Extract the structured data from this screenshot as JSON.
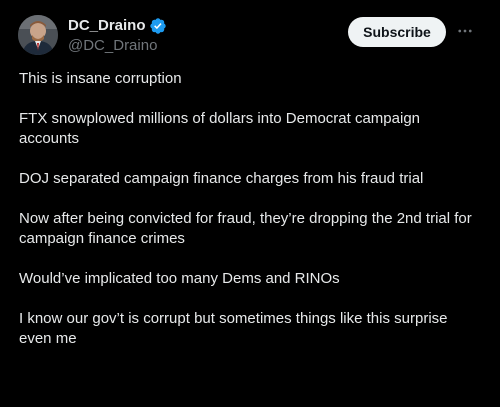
{
  "author": {
    "display_name": "DC_Draino",
    "handle": "@DC_Draino",
    "verified": true
  },
  "actions": {
    "subscribe_label": "Subscribe",
    "more_icon": "more-horizontal-icon"
  },
  "colors": {
    "background": "#000000",
    "text": "#e7e9ea",
    "secondary_text": "#71767b",
    "verified_badge": "#1d9bf0",
    "subscribe_bg": "#eff3f4"
  },
  "tweet": {
    "paragraphs": [
      "This is insane corruption",
      "FTX snowplowed millions of dollars into Democrat campaign accounts",
      "DOJ separated campaign finance charges from his fraud trial",
      "Now after being convicted for fraud, they’re dropping the 2nd trial for campaign finance crimes",
      "Would’ve implicated too many Dems and RINOs",
      "I know our gov’t is corrupt but sometimes things like this surprise even me"
    ]
  }
}
